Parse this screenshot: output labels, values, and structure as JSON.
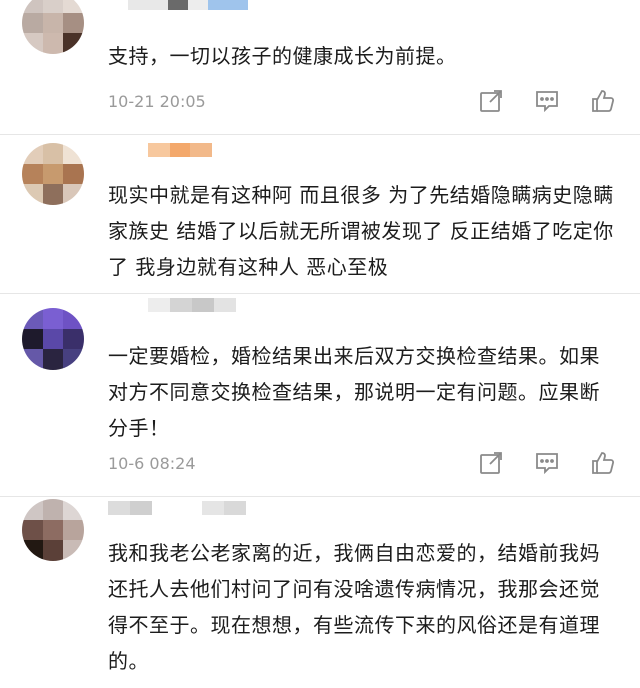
{
  "comments": [
    {
      "text": "支持，一切以孩子的健康成长为前提。",
      "time": "10-21 20:05",
      "has_actions": true
    },
    {
      "text": "现实中就是有这种阿 而且很多 为了先结婚隐瞒病史隐瞒家族史 结婚了以后就无所谓被发现了 反正结婚了吃定你了 我身边就有这种人 恶心至极",
      "time": "",
      "has_actions": false
    },
    {
      "text": "一定要婚检，婚检结果出来后双方交换检查结果。如果对方不同意交换检查结果，那说明一定有问题。应果断分手！",
      "time": "10-6 08:24",
      "has_actions": true
    },
    {
      "text": "我和我老公老家离的近，我俩自由恋爱的，结婚前我妈还托人去他们村问了问有没啥遗传病情况，我那会还觉得不至于。现在想想，有些流传下来的风俗还是有道理的。",
      "time": "",
      "has_actions": false
    }
  ],
  "icons": {
    "share": "share-icon",
    "reply": "comment-icon",
    "like": "thumbs-up-icon"
  }
}
